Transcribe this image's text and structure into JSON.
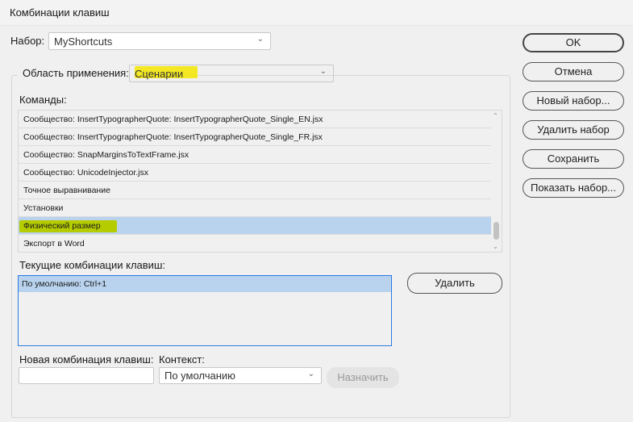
{
  "window": {
    "title": "Комбинации клавиш"
  },
  "set": {
    "label": "Набор:",
    "value": "MyShortcuts"
  },
  "area": {
    "label": "Область применения:",
    "value": "Сценарии"
  },
  "commands": {
    "label": "Команды:",
    "items": [
      "Сообщество: InsertTypographerQuote: InsertTypographerQuote_Single_EN.jsx",
      "Сообщество: InsertTypographerQuote: InsertTypographerQuote_Single_FR.jsx",
      "Сообщество: SnapMarginsToTextFrame.jsx",
      "Сообщество: UnicodeInjector.jsx",
      "Точное выравнивание",
      "Установки",
      "Физический размер",
      "Экспорт в Word"
    ],
    "selected_index": 6
  },
  "current": {
    "label": "Текущие комбинации клавиш:",
    "items": [
      "По умолчанию: Ctrl+1"
    ],
    "delete_label": "Удалить"
  },
  "new_shortcut": {
    "label": "Новая комбинация клавиш:",
    "value": "",
    "context_label": "Контекст:",
    "context_value": "По умолчанию",
    "assign_label": "Назначить"
  },
  "buttons": {
    "ok": "OK",
    "cancel": "Отмена",
    "new_set": "Новый набор...",
    "delete_set": "Удалить набор",
    "save": "Сохранить",
    "show_set": "Показать набор..."
  },
  "colors": {
    "selection": "#b9d3ee",
    "highlight_yellow": "#f5e600",
    "highlight_green": "#b5cc00"
  }
}
